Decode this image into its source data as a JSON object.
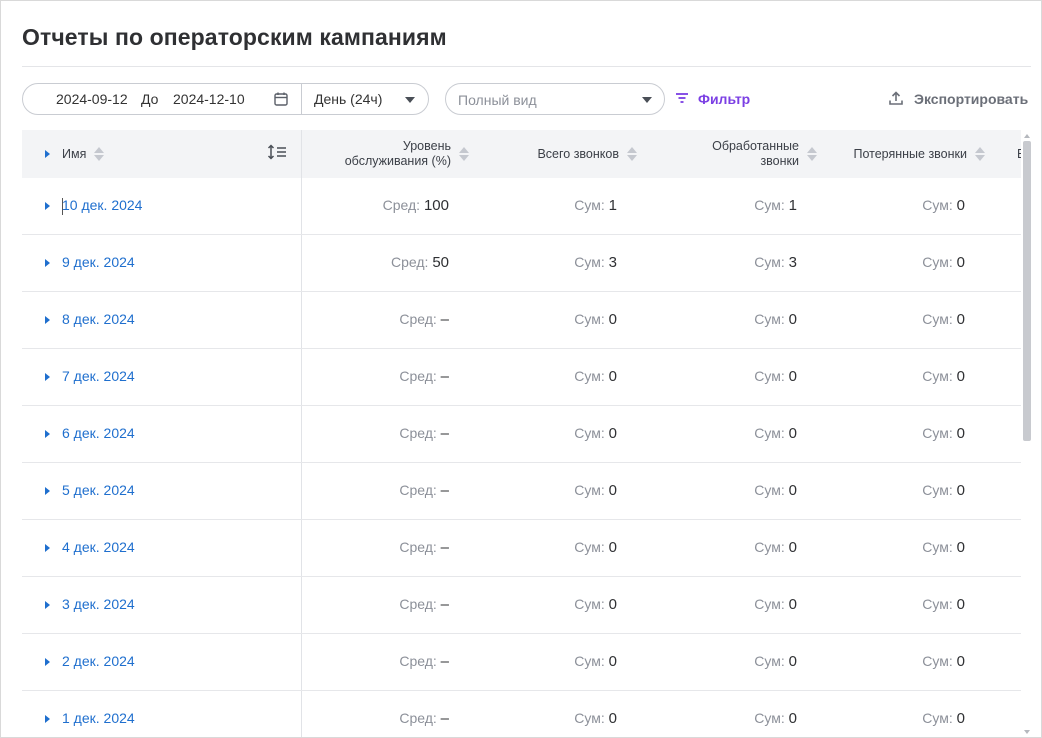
{
  "page": {
    "title": "Отчеты по операторским кампаниям"
  },
  "toolbar": {
    "date_from": "2024-09-12",
    "to_label": "До",
    "date_to": "2024-12-10",
    "period": "День (24ч)",
    "view_placeholder": "Полный вид",
    "filter_label": "Фильтр",
    "export_label": "Экспортировать"
  },
  "table": {
    "columns": {
      "name": "Имя",
      "service_level": "Уровень обслуживания (%)",
      "total_calls": "Всего звонков",
      "handled_calls": "Обработанные звонки",
      "lost_calls": "Потерянные звонки",
      "next_partial": "В"
    },
    "rows": [
      {
        "name": "10 дек. 2024",
        "sl_key": "Сред:",
        "sl": "100",
        "tc_key": "Сум:",
        "tc": "1",
        "hc_key": "Сум:",
        "hc": "1",
        "lc_key": "Сум:",
        "lc": "0"
      },
      {
        "name": "9 дек. 2024",
        "sl_key": "Сред:",
        "sl": "50",
        "tc_key": "Сум:",
        "tc": "3",
        "hc_key": "Сум:",
        "hc": "3",
        "lc_key": "Сум:",
        "lc": "0"
      },
      {
        "name": "8 дек. 2024",
        "sl_key": "Сред:",
        "sl": "–",
        "tc_key": "Сум:",
        "tc": "0",
        "hc_key": "Сум:",
        "hc": "0",
        "lc_key": "Сум:",
        "lc": "0"
      },
      {
        "name": "7 дек. 2024",
        "sl_key": "Сред:",
        "sl": "–",
        "tc_key": "Сум:",
        "tc": "0",
        "hc_key": "Сум:",
        "hc": "0",
        "lc_key": "Сум:",
        "lc": "0"
      },
      {
        "name": "6 дек. 2024",
        "sl_key": "Сред:",
        "sl": "–",
        "tc_key": "Сум:",
        "tc": "0",
        "hc_key": "Сум:",
        "hc": "0",
        "lc_key": "Сум:",
        "lc": "0"
      },
      {
        "name": "5 дек. 2024",
        "sl_key": "Сред:",
        "sl": "–",
        "tc_key": "Сум:",
        "tc": "0",
        "hc_key": "Сум:",
        "hc": "0",
        "lc_key": "Сум:",
        "lc": "0"
      },
      {
        "name": "4 дек. 2024",
        "sl_key": "Сред:",
        "sl": "–",
        "tc_key": "Сум:",
        "tc": "0",
        "hc_key": "Сум:",
        "hc": "0",
        "lc_key": "Сум:",
        "lc": "0"
      },
      {
        "name": "3 дек. 2024",
        "sl_key": "Сред:",
        "sl": "–",
        "tc_key": "Сум:",
        "tc": "0",
        "hc_key": "Сум:",
        "hc": "0",
        "lc_key": "Сум:",
        "lc": "0"
      },
      {
        "name": "2 дек. 2024",
        "sl_key": "Сред:",
        "sl": "–",
        "tc_key": "Сум:",
        "tc": "0",
        "hc_key": "Сум:",
        "hc": "0",
        "lc_key": "Сум:",
        "lc": "0"
      },
      {
        "name": "1 дек. 2024",
        "sl_key": "Сред:",
        "sl": "–",
        "tc_key": "Сум:",
        "tc": "0",
        "hc_key": "Сум:",
        "hc": "0",
        "lc_key": "Сум:",
        "lc": "0"
      }
    ]
  },
  "icons": {
    "calendar": "calendar-icon",
    "filter": "filter-icon",
    "export": "upload-icon",
    "row_height": "row-height-icon",
    "sort": "sort-icon",
    "expand": "caret-right-icon"
  },
  "colors": {
    "link": "#1f6fce",
    "accent": "#7b3fe4",
    "header_bg": "#f3f4f6"
  }
}
